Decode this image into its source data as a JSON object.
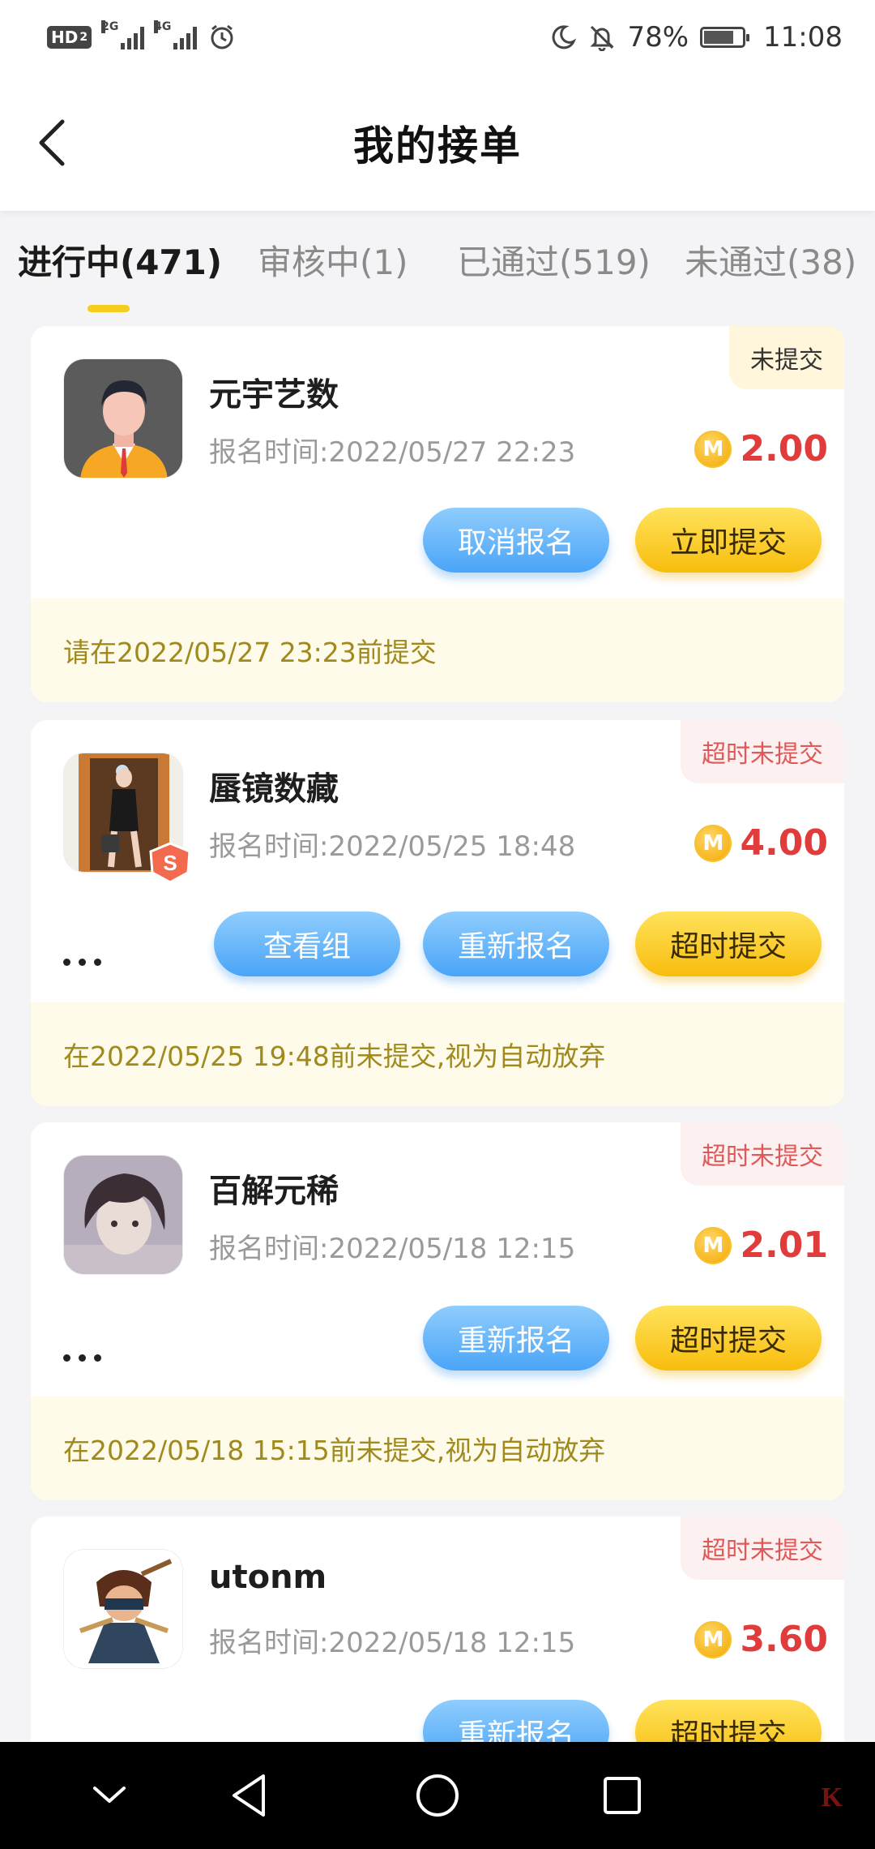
{
  "status_bar": {
    "hd_label": "HD",
    "hd_sub": "2",
    "net1": "2G",
    "net2": "4G",
    "battery_percent": "78%",
    "time": "11:08"
  },
  "header": {
    "title": "我的接单"
  },
  "tabs": [
    {
      "label": "进行中(471)",
      "active": true
    },
    {
      "label": "审核中(1)",
      "active": false
    },
    {
      "label": "已通过(519)",
      "active": false
    },
    {
      "label": "未通过(38)",
      "active": false
    }
  ],
  "orders": [
    {
      "name": "元宇艺数",
      "signup_time": "报名时间:2022/05/27 22:23",
      "reward": "2.00",
      "status": "未提交",
      "buttons": [
        "取消报名",
        "立即提交"
      ],
      "notice": "请在2022/05/27 23:23前提交"
    },
    {
      "name": "蜃镜数藏",
      "signup_time": "报名时间:2022/05/25 18:48",
      "reward": "4.00",
      "status": "超时未提交",
      "buttons": [
        "查看组",
        "重新报名",
        "超时提交"
      ],
      "notice": "在2022/05/25 19:48前未提交,视为自动放弃"
    },
    {
      "name": "百解元稀",
      "signup_time": "报名时间:2022/05/18 12:15",
      "reward": "2.01",
      "status": "超时未提交",
      "buttons": [
        "重新报名",
        "超时提交"
      ],
      "notice": "在2022/05/18 15:15前未提交,视为自动放弃"
    },
    {
      "name": "utonm",
      "signup_time": "报名时间:2022/05/18 12:15",
      "reward": "3.60",
      "status": "超时未提交",
      "buttons": [
        "重新报名",
        "超时提交"
      ]
    }
  ],
  "coin_symbol": "M",
  "badge_letter": "S",
  "colors": {
    "accent_yellow": "#f6cd1f",
    "reward_red": "#e03c3c",
    "overdue_red": "#e05959",
    "notice_text": "#a08a1e",
    "button_blue": "#4aa4f7"
  },
  "icons": [
    "back-icon",
    "moon-icon",
    "bell-off-icon",
    "alarm-icon",
    "coin-icon",
    "more-icon",
    "nav-back-icon",
    "nav-home-icon",
    "nav-recents-icon",
    "nav-collapse-icon"
  ]
}
